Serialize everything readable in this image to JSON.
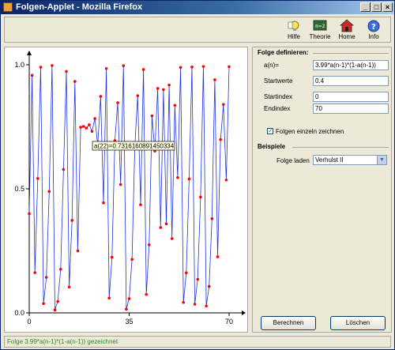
{
  "window": {
    "title": "Folgen-Applet - Mozilla Firefox"
  },
  "toolbar": {
    "items": [
      {
        "label": "Hilfe",
        "icon": "help-lightbulb-icon"
      },
      {
        "label": "Theorie",
        "icon": "theory-board-icon"
      },
      {
        "label": "Home",
        "icon": "home-icon"
      },
      {
        "label": "Info",
        "icon": "info-icon"
      }
    ]
  },
  "definition": {
    "title": "Folge definieren:",
    "formula_label": "a(n)=",
    "formula_value": "3.99*a(n-1)*(1-a(n-1))",
    "start_label": "Startwerte",
    "start_value": "0.4",
    "startindex_label": "Startindex",
    "startindex_value": "0",
    "endindex_label": "Endindex",
    "endindex_value": "70",
    "single_label": "Folgen einzeln zeichnen",
    "single_checked": true
  },
  "examples": {
    "title": "Beispiele",
    "load_label": "Folge laden",
    "load_value": "Verhulst II"
  },
  "buttons": {
    "compute": "Berechnen",
    "clear": "Löschen"
  },
  "status": "Folge 3.99*a(n-1)*(1-a(n-1)) gezeichnet",
  "tooltip": "a(22)=0.7316160891450334",
  "colors": {
    "line": "#2233dd",
    "point": "#ff0000",
    "status": "#2a8a2a"
  },
  "chart_data": {
    "type": "scatter",
    "title": "",
    "xlabel": "",
    "ylabel": "",
    "x_ticks": [
      "0",
      "35",
      "70"
    ],
    "y_ticks": [
      "0.0",
      "0.5",
      "1.0"
    ],
    "xlim": [
      0,
      70
    ],
    "ylim": [
      0,
      1
    ],
    "a0": 0.4,
    "r": 3.99,
    "n_points": 71
  }
}
